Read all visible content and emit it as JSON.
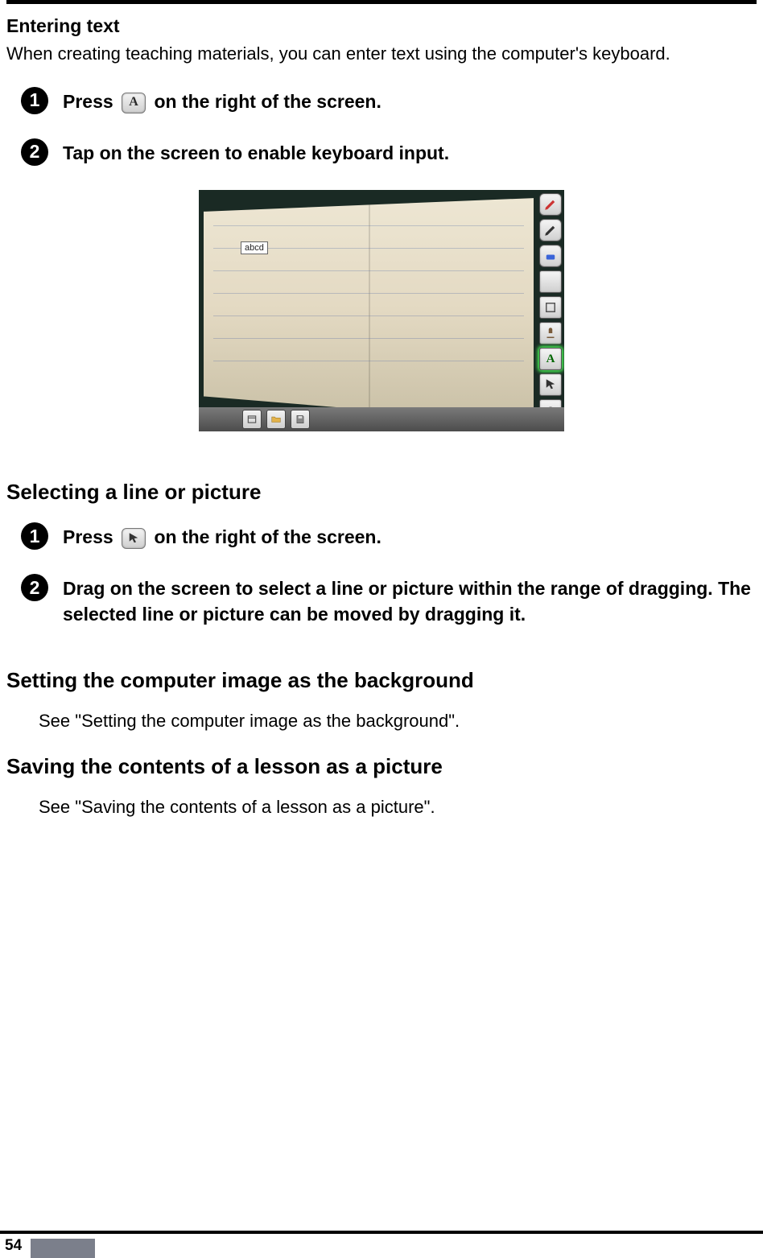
{
  "page_number": "54",
  "section1": {
    "title": "Entering text",
    "intro": "When creating teaching materials, you can enter text using the computer's keyboard.",
    "steps": [
      {
        "num": "1",
        "pre": "Press",
        "icon_letter": "A",
        "post": " on the right of the screen."
      },
      {
        "num": "2",
        "text": "Tap on the screen to enable keyboard input."
      }
    ]
  },
  "screenshot": {
    "input_text": "abcd",
    "right_tools": [
      "pen-red-icon",
      "pen-black-icon",
      "eraser-icon",
      "blank-icon",
      "shape-icon",
      "stamp-icon",
      "text-A-icon",
      "cursor-icon",
      "help-icon"
    ],
    "taskbar_icons": [
      "window-icon",
      "folder-icon",
      "save-icon"
    ]
  },
  "section2": {
    "title": "Selecting a line or picture",
    "steps": [
      {
        "num": "1",
        "pre": "Press",
        "icon": "cursor",
        "post": " on the right of the screen."
      },
      {
        "num": "2",
        "text": "Drag on the screen to select a line or picture within the range of dragging. The selected line or picture can be moved by dragging it."
      }
    ]
  },
  "section3": {
    "title": "Setting the computer image as the background",
    "sub": "See \"Setting the computer image as the background\"."
  },
  "section4": {
    "title": "Saving the contents of a lesson as a picture",
    "sub": "See \"Saving the contents of a lesson as a picture\"."
  }
}
